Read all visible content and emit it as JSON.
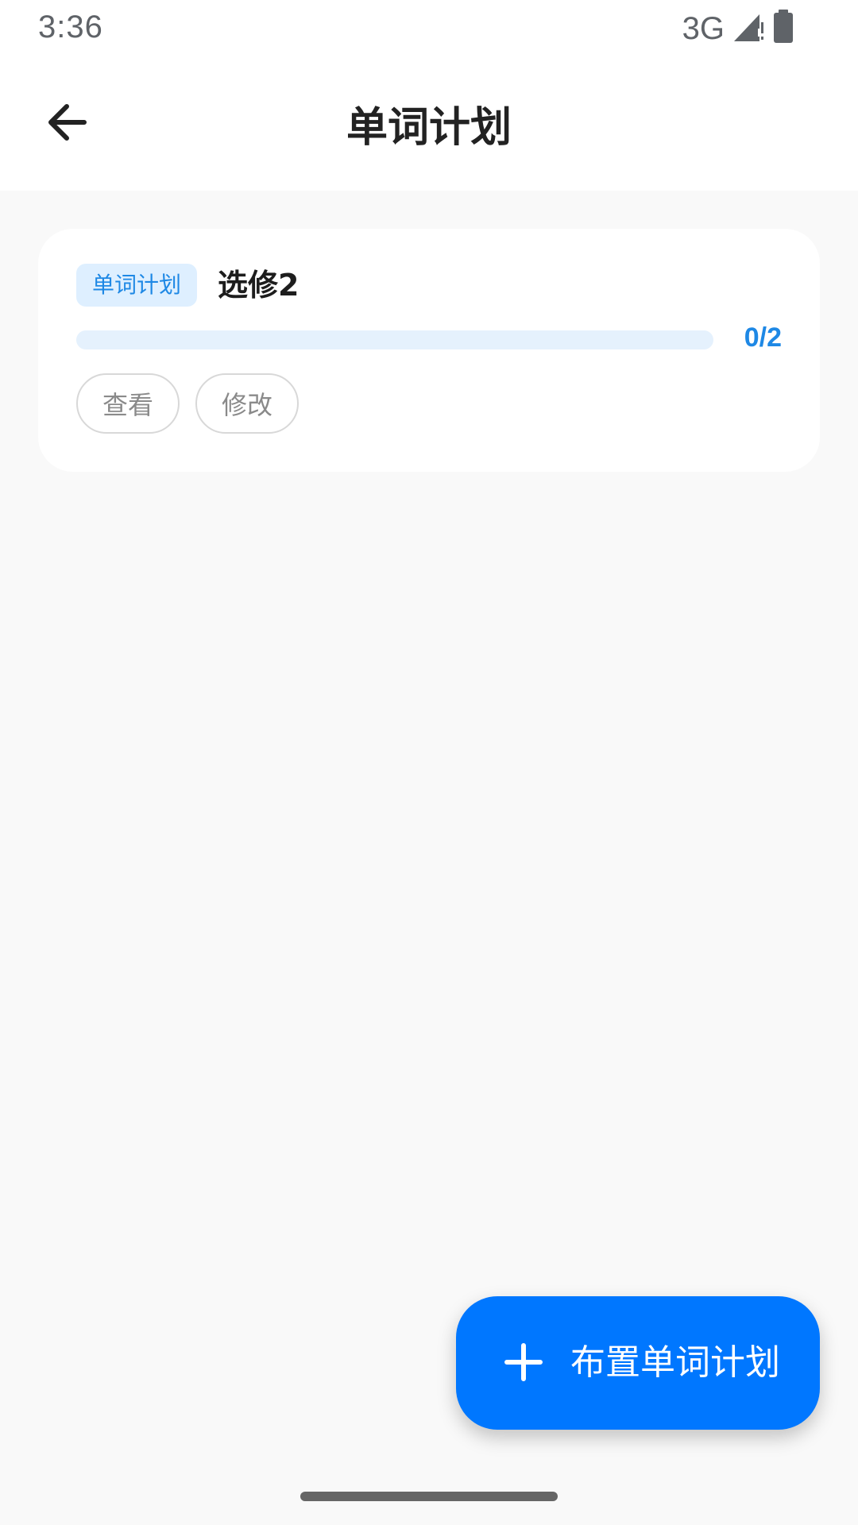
{
  "status_bar": {
    "time": "3:36",
    "network": "3G",
    "icons": [
      "signal-icon",
      "battery-icon"
    ]
  },
  "header": {
    "title": "单词计划",
    "back_icon": "arrow-left-icon"
  },
  "plan_card": {
    "tag": "单词计划",
    "name": "选修2",
    "progress_text": "0/2",
    "progress_fraction": 0,
    "view_label": "查看",
    "edit_label": "修改"
  },
  "fab": {
    "icon": "plus-icon",
    "label": "布置单词计划"
  },
  "colors": {
    "accent": "#1e88e5",
    "fab": "#0077ff",
    "tag_bg": "#deefff",
    "background": "#f9f9f9"
  }
}
